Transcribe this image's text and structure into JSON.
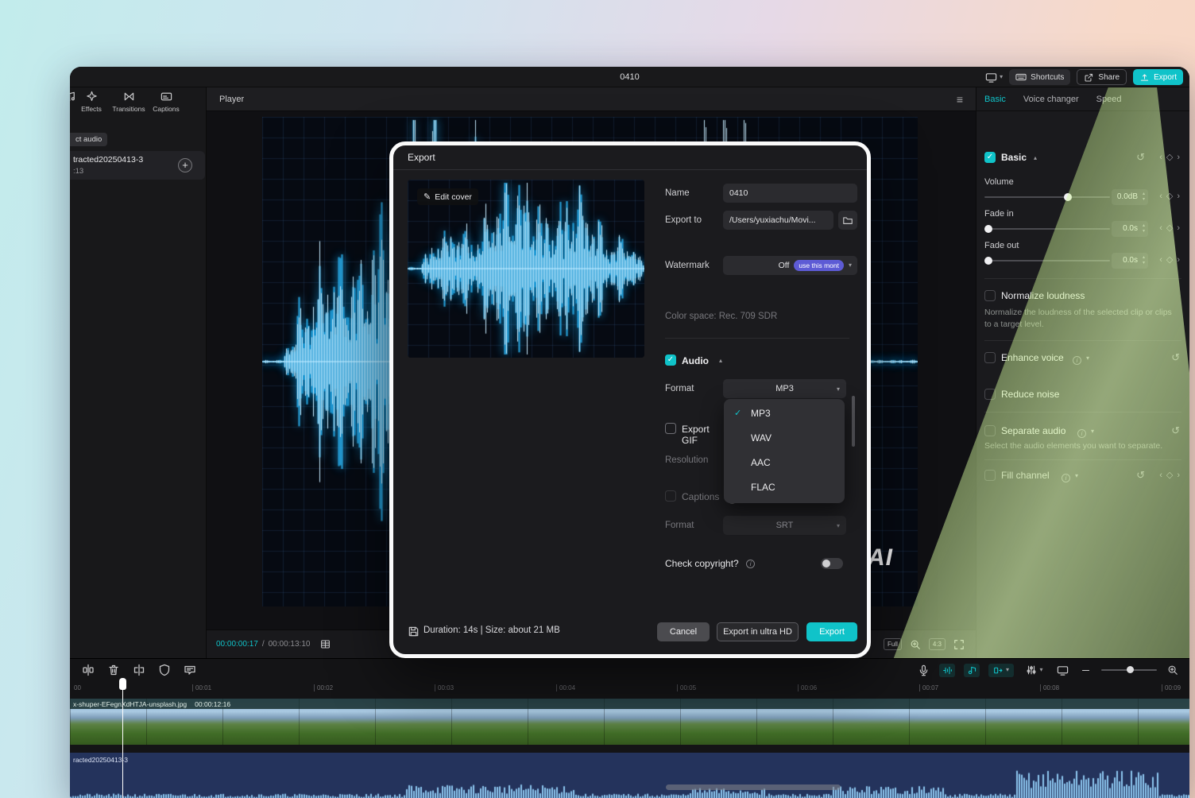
{
  "app": {
    "title": "0410"
  },
  "titlebar": {
    "shortcuts_label": "Shortcuts",
    "share_label": "Share",
    "export_label": "Export"
  },
  "left_panel": {
    "tools": [
      {
        "label": "Effects"
      },
      {
        "label": "Transitions"
      },
      {
        "label": "Captions"
      }
    ],
    "extract_tag": "ct audio",
    "media_item": {
      "name": "tracted20250413-3",
      "duration": ":13"
    }
  },
  "player": {
    "header": "Player",
    "current_time": "00:00:00:17",
    "time_separator": "/",
    "total_time": "00:00:13:10",
    "overlay_text": "AI",
    "full_label": "Full",
    "ratio_label": "4:3"
  },
  "right_panel": {
    "tabs": [
      {
        "label": "Basic"
      },
      {
        "label": "Voice changer"
      },
      {
        "label": "Speed"
      }
    ],
    "basic_section": "Basic",
    "volume": {
      "label": "Volume",
      "value": "0.0dB"
    },
    "fade_in": {
      "label": "Fade in",
      "value": "0.0s"
    },
    "fade_out": {
      "label": "Fade out",
      "value": "0.0s"
    },
    "normalize": {
      "label": "Normalize loudness",
      "description": "Normalize the loudness of the selected clip or clips to a target level."
    },
    "enhance_voice": {
      "label": "Enhance voice"
    },
    "reduce_noise": {
      "label": "Reduce noise"
    },
    "separate_audio": {
      "label": "Separate audio",
      "description": "Select the audio elements you want to separate."
    },
    "fill_channel": {
      "label": "Fill channel"
    }
  },
  "dialog": {
    "title": "Export",
    "edit_cover_label": "Edit cover",
    "name": {
      "label": "Name",
      "value": "0410"
    },
    "export_to": {
      "label": "Export to",
      "value": "/Users/yuxiachu/Movi..."
    },
    "watermark": {
      "label": "Watermark",
      "value": "Off",
      "badge": "use this mont"
    },
    "color_space": "Color space: Rec. 709 SDR",
    "audio_section": "Audio",
    "format": {
      "label": "Format",
      "value": "MP3"
    },
    "format_options": [
      {
        "label": "MP3"
      },
      {
        "label": "WAV"
      },
      {
        "label": "AAC"
      },
      {
        "label": "FLAC"
      }
    ],
    "export_gif_label": "Export GIF",
    "resolution_label": "Resolution",
    "captions_label": "Captions",
    "caption_format": {
      "label": "Format",
      "value": "SRT"
    },
    "copyright_label": "Check copyright?",
    "footer": {
      "summary": "Duration: 14s | Size: about 21 MB",
      "cancel_label": "Cancel",
      "ultra_hd_label": "Export in ultra HD",
      "export_label": "Export"
    }
  },
  "timeline": {
    "ruler": [
      "00",
      "00:01",
      "00:02",
      "00:03",
      "00:04",
      "00:05",
      "00:06",
      "00:07",
      "00:08",
      "00:09"
    ],
    "video_clip": {
      "name": "x-shuper-EFegnXdHTJA-unsplash.jpg",
      "duration": "00:00:12:16"
    },
    "audio_clip": {
      "name": "racted20250413-3"
    }
  },
  "colors": {
    "accent": "#10c3c9",
    "badge_purple": "#5d5bd5",
    "waveform_blue": "#49c8ff"
  }
}
